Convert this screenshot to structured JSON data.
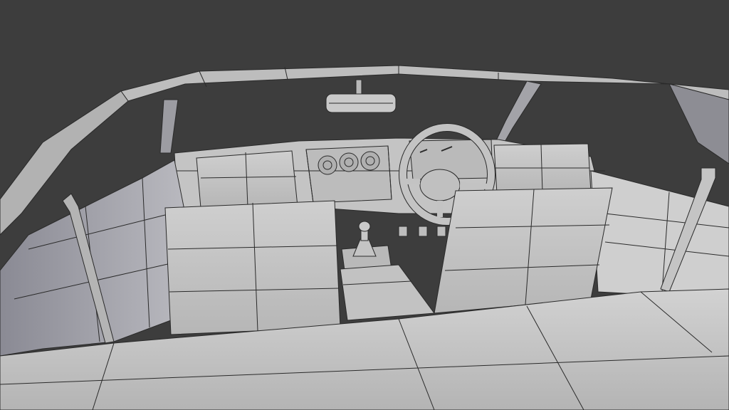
{
  "scene": {
    "background": "#3d3d3d",
    "mesh_fill": "#c8c8c8",
    "mesh_shade": "#a9a9ad",
    "mesh_dark": "#7d7d85",
    "wire": "#2a2a2a",
    "objects": [
      "windshield-frame",
      "rearview-mirror",
      "dashboard",
      "gauge-cluster",
      "steering-wheel",
      "driver-seat",
      "passenger-seat",
      "gear-shifter",
      "center-console",
      "pedals",
      "seat-belts",
      "door-panels",
      "rear-trim"
    ]
  }
}
